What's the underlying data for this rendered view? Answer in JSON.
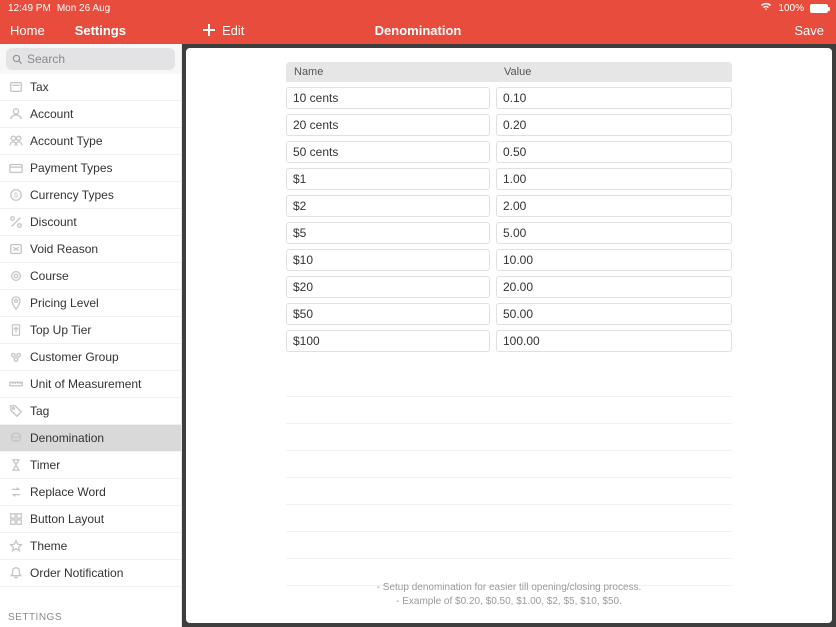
{
  "statusbar": {
    "time": "12:49 PM",
    "date": "Mon 26 Aug",
    "wifi_icon": "wifi",
    "battery_text": "100%"
  },
  "nav": {
    "home": "Home",
    "settings": "Settings",
    "edit": "Edit",
    "title": "Denomination",
    "save": "Save"
  },
  "search": {
    "placeholder": "Search"
  },
  "sidebar": {
    "items": [
      {
        "label": "Tax",
        "icon": "tax"
      },
      {
        "label": "Account",
        "icon": "user"
      },
      {
        "label": "Account Type",
        "icon": "users"
      },
      {
        "label": "Payment Types",
        "icon": "card"
      },
      {
        "label": "Currency Types",
        "icon": "currency"
      },
      {
        "label": "Discount",
        "icon": "percent"
      },
      {
        "label": "Void Reason",
        "icon": "void"
      },
      {
        "label": "Course",
        "icon": "course"
      },
      {
        "label": "Pricing Level",
        "icon": "pin"
      },
      {
        "label": "Top Up Tier",
        "icon": "topup"
      },
      {
        "label": "Customer Group",
        "icon": "group"
      },
      {
        "label": "Unit of Measurement",
        "icon": "ruler"
      },
      {
        "label": "Tag",
        "icon": "tag"
      },
      {
        "label": "Denomination",
        "icon": "coin",
        "selected": true
      },
      {
        "label": "Timer",
        "icon": "hourglass"
      },
      {
        "label": "Replace Word",
        "icon": "replace"
      },
      {
        "label": "Button Layout",
        "icon": "layout"
      },
      {
        "label": "Theme",
        "icon": "theme"
      },
      {
        "label": "Order Notification",
        "icon": "bell"
      }
    ],
    "section_header": "SETTINGS"
  },
  "table": {
    "header_name": "Name",
    "header_value": "Value",
    "rows": [
      {
        "name": "10 cents",
        "value": "0.10"
      },
      {
        "name": "20 cents",
        "value": "0.20"
      },
      {
        "name": "50 cents",
        "value": "0.50"
      },
      {
        "name": "$1",
        "value": "1.00"
      },
      {
        "name": "$2",
        "value": "2.00"
      },
      {
        "name": "$5",
        "value": "5.00"
      },
      {
        "name": "$10",
        "value": "10.00"
      },
      {
        "name": "$20",
        "value": "20.00"
      },
      {
        "name": "$50",
        "value": "50.00"
      },
      {
        "name": "$100",
        "value": "100.00"
      }
    ]
  },
  "footer": {
    "line1": "- Setup denomination for easier till opening/closing process.",
    "line2": "- Example of $0.20, $0.50, $1.00, $2, $5, $10, $50."
  }
}
